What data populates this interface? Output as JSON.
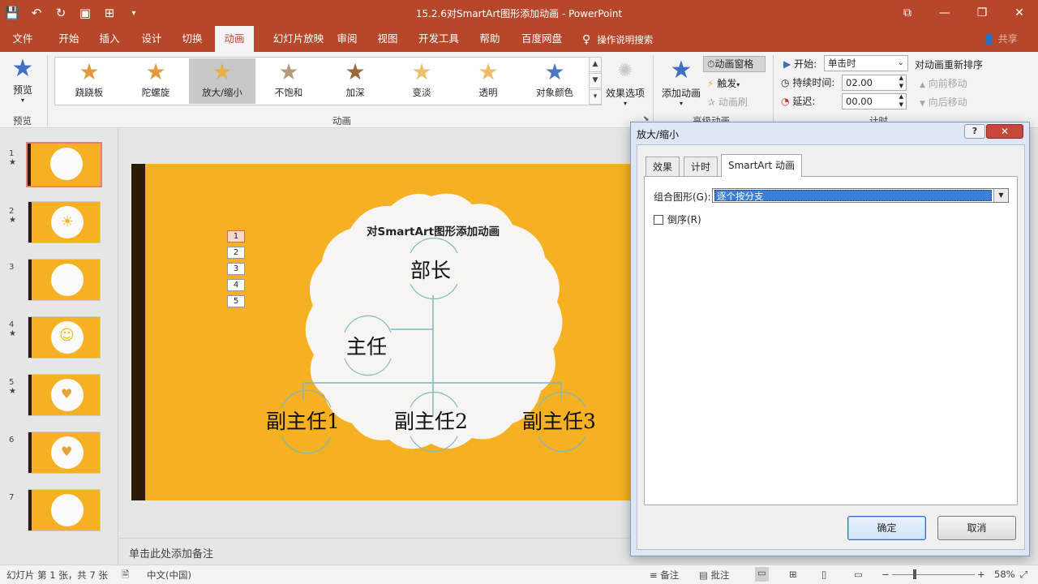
{
  "window": {
    "title": "15.2.6对SmartArt图形添加动画 - PowerPoint",
    "qat_icons": [
      "save-icon",
      "undo-icon",
      "redo-icon",
      "present-icon",
      "touch-icon",
      "customize-icon"
    ]
  },
  "menu": {
    "tabs": [
      "文件",
      "开始",
      "插入",
      "设计",
      "切换",
      "动画",
      "幻灯片放映",
      "审阅",
      "视图",
      "开发工具",
      "帮助",
      "百度网盘"
    ],
    "active": "动画",
    "tell_me": "操作说明搜索",
    "share": "共享"
  },
  "ribbon": {
    "preview_label": "预览",
    "preview_group": "预览",
    "animation_group": "动画",
    "animations": [
      {
        "label": "跷跷板",
        "color": "#e39a3d"
      },
      {
        "label": "陀螺旋",
        "color": "#e39a3d"
      },
      {
        "label": "放大/缩小",
        "color": "#e3b14a"
      },
      {
        "label": "不饱和",
        "color": "#b89a7a"
      },
      {
        "label": "加深",
        "color": "#9a6a3a"
      },
      {
        "label": "变淡",
        "color": "#ecc06a"
      },
      {
        "label": "透明",
        "color": "#eebb66"
      },
      {
        "label": "对象颜色",
        "color": "#4a78c2"
      }
    ],
    "selected_animation": "放大/缩小",
    "effect_options": "效果选项",
    "add_animation": "添加动画",
    "animation_pane": "动画窗格",
    "trigger": "触发",
    "animation_painter": "动画刷",
    "advanced_group": "高级动画",
    "start_label": "开始:",
    "start_value": "单击时",
    "duration_label": "持续时间:",
    "duration_value": "02.00",
    "delay_label": "延迟:",
    "delay_value": "00.00",
    "timing_group": "计时",
    "reorder_title": "对动画重新排序",
    "move_earlier": "向前移动",
    "move_later": "向后移动"
  },
  "slides": {
    "count": 7,
    "selected": 1,
    "star_marked": [
      1,
      2,
      4,
      5
    ]
  },
  "slide": {
    "title": "对SmartArt图形添加动画",
    "nodes": {
      "top": "部长",
      "assistant": "主任",
      "sub1": "副主任1",
      "sub2": "副主任2",
      "sub3": "副主任3"
    },
    "order_tags": [
      "1",
      "2",
      "3",
      "4",
      "5"
    ]
  },
  "notes": {
    "placeholder": "单击此处添加备注"
  },
  "status": {
    "slide_info": "幻灯片 第 1 张，共 7 张",
    "language": "中文(中国)",
    "notes": "备注",
    "comments": "批注",
    "zoom": "58%"
  },
  "dialog": {
    "title": "放大/缩小",
    "help": "?",
    "close": "✕",
    "tabs": [
      "效果",
      "计时",
      "SmartArt 动画"
    ],
    "active_tab": "SmartArt 动画",
    "group_label": "组合图形(G):",
    "group_value": "逐个按分支",
    "reverse_label": "倒序(R)",
    "reverse_checked": false,
    "ok": "确定",
    "cancel": "取消"
  }
}
